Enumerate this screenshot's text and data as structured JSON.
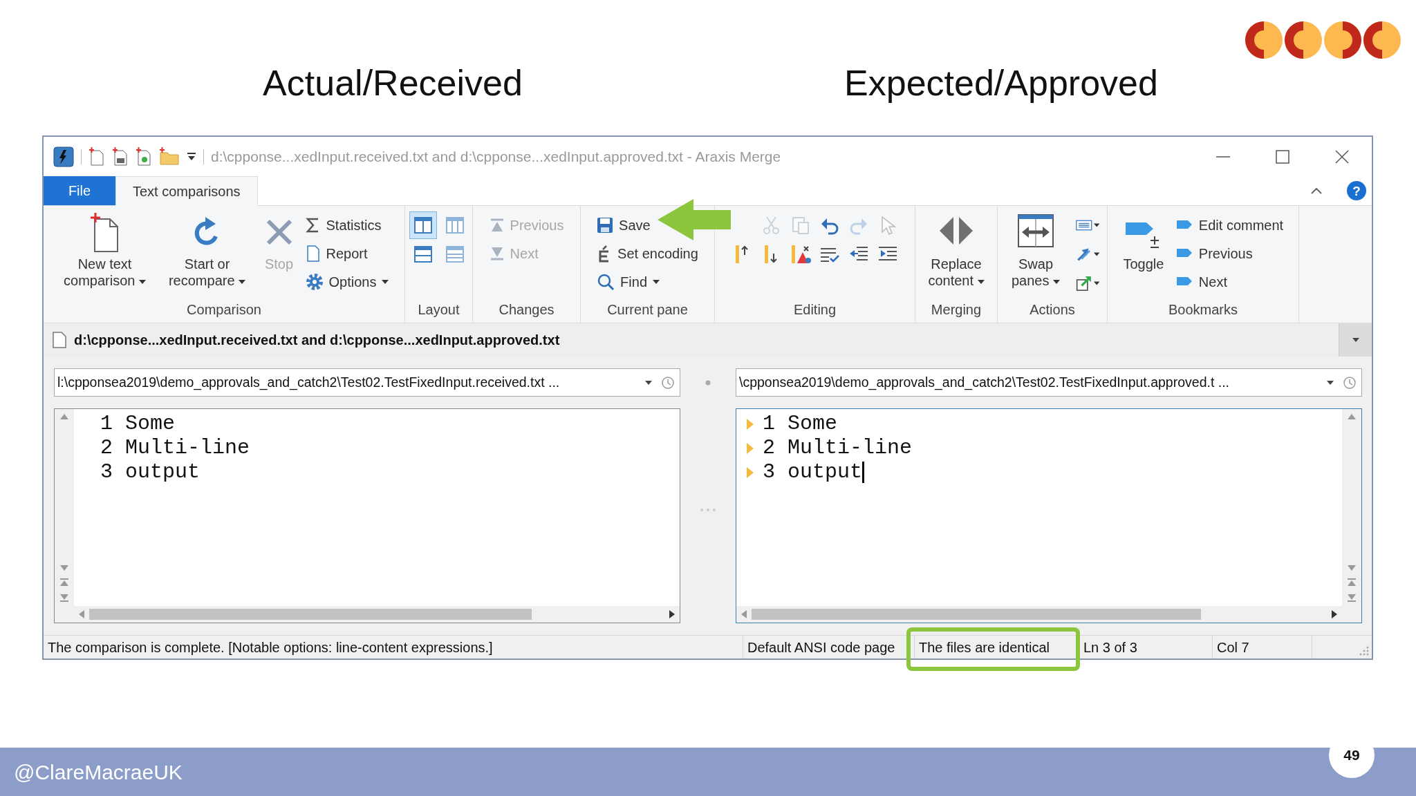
{
  "slide": {
    "heading_left": "Actual/Received",
    "heading_right": "Expected/Approved",
    "footer_handle": "@ClareMacraeUK",
    "page_number": "49"
  },
  "window": {
    "title": "d:\\cpponse...xedInput.received.txt and d:\\cpponse...xedInput.approved.txt - Araxis Merge"
  },
  "ribbon_tabs": [
    {
      "label": "File",
      "kind": "file",
      "selected": false
    },
    {
      "label": "Text comparisons",
      "kind": "tab",
      "selected": true
    }
  ],
  "help_button": {
    "label": "?"
  },
  "ribbon_groups": [
    {
      "label": "Comparison",
      "items": [
        {
          "kind": "large",
          "label": "New text comparison",
          "dropdown": true,
          "disabled": false
        },
        {
          "kind": "large",
          "label": "Start or recompare",
          "dropdown": true,
          "disabled": false
        },
        {
          "kind": "large",
          "label": "Stop",
          "dropdown": false,
          "disabled": true
        },
        {
          "kind": "small",
          "label": "Statistics",
          "dropdown": false,
          "disabled": false
        },
        {
          "kind": "small",
          "label": "Report",
          "dropdown": false,
          "disabled": false
        },
        {
          "kind": "small",
          "label": "Options",
          "dropdown": true,
          "disabled": false
        }
      ]
    },
    {
      "label": "Layout",
      "items": [
        {
          "kind": "icon",
          "selected": true
        },
        {
          "kind": "icon",
          "selected": false
        },
        {
          "kind": "icon",
          "selected": false
        },
        {
          "kind": "icon",
          "selected": false
        }
      ]
    },
    {
      "label": "Changes",
      "items": [
        {
          "kind": "small",
          "label": "Previous",
          "dropdown": false,
          "disabled": true
        },
        {
          "kind": "small",
          "label": "Next",
          "dropdown": false,
          "disabled": true
        }
      ]
    },
    {
      "label": "Current pane",
      "items": [
        {
          "kind": "small",
          "label": "Save",
          "dropdown": false,
          "disabled": false
        },
        {
          "kind": "small",
          "label": "Set encoding",
          "dropdown": false,
          "disabled": false
        },
        {
          "kind": "small",
          "label": "Find",
          "dropdown": true,
          "disabled": false
        }
      ]
    },
    {
      "label": "Editing",
      "items": [
        {
          "kind": "icon",
          "dropdown": false,
          "disabled": true
        },
        {
          "kind": "icon",
          "dropdown": false,
          "disabled": true
        },
        {
          "kind": "icon",
          "dropdown": false,
          "disabled": false
        },
        {
          "kind": "icon",
          "dropdown": false,
          "disabled": true
        },
        {
          "kind": "icon",
          "dropdown": false,
          "disabled": true
        },
        {
          "kind": "icon",
          "dropdown": false,
          "disabled": false
        },
        {
          "kind": "icon",
          "dropdown": false,
          "disabled": false
        },
        {
          "kind": "icon",
          "dropdown": false,
          "disabled": false
        },
        {
          "kind": "icon",
          "dropdown": false,
          "disabled": false
        },
        {
          "kind": "icon",
          "dropdown": false,
          "disabled": false
        },
        {
          "kind": "icon",
          "dropdown": false,
          "disabled": false
        }
      ]
    },
    {
      "label": "Merging",
      "items": [
        {
          "kind": "large",
          "label": "Replace content",
          "dropdown": true,
          "disabled": false
        }
      ]
    },
    {
      "label": "Actions",
      "items": [
        {
          "kind": "large",
          "label": "Swap panes",
          "dropdown": true,
          "disabled": false
        },
        {
          "kind": "icon",
          "dropdown": true,
          "disabled": false
        },
        {
          "kind": "icon",
          "dropdown": true,
          "disabled": false
        },
        {
          "kind": "icon",
          "dropdown": true,
          "disabled": false
        }
      ]
    },
    {
      "label": "Bookmarks",
      "items": [
        {
          "kind": "large",
          "label": "Toggle",
          "dropdown": false,
          "disabled": false
        },
        {
          "kind": "small",
          "label": "Edit comment",
          "dropdown": false,
          "disabled": false
        },
        {
          "kind": "small",
          "label": "Previous",
          "dropdown": false,
          "disabled": false
        },
        {
          "kind": "small",
          "label": "Next",
          "dropdown": false,
          "disabled": false
        }
      ]
    }
  ],
  "document_tab": {
    "title": "d:\\cpponse...xedInput.received.txt and d:\\cpponse...xedInput.approved.txt"
  },
  "panes": [
    {
      "path": "l:\\cpponsea2019\\demo_approvals_and_catch2\\Test02.TestFixedInput.received.txt ...",
      "focused": false,
      "lines": [
        {
          "number": "1",
          "text": "Some",
          "marked": false,
          "cursor": false
        },
        {
          "number": "2",
          "text": "Multi-line",
          "marked": false,
          "cursor": false
        },
        {
          "number": "3",
          "text": "output",
          "marked": false,
          "cursor": false
        }
      ]
    },
    {
      "path": "\\cpponsea2019\\demo_approvals_and_catch2\\Test02.TestFixedInput.approved.t ...",
      "focused": true,
      "lines": [
        {
          "number": "1",
          "text": "Some",
          "marked": true,
          "cursor": false
        },
        {
          "number": "2",
          "text": "Multi-line",
          "marked": true,
          "cursor": false
        },
        {
          "number": "3",
          "text": "output",
          "marked": true,
          "cursor": true
        }
      ]
    }
  ],
  "status_bar": [
    {
      "text": "The comparison is complete. [Notable options: line-content expressions.]",
      "highlighted": false
    },
    {
      "text": "Default ANSI code page",
      "highlighted": false
    },
    {
      "text": "The files are identical",
      "highlighted": true
    },
    {
      "text": "Ln 3 of 3",
      "highlighted": false
    },
    {
      "text": "Col 7",
      "highlighted": false
    }
  ]
}
